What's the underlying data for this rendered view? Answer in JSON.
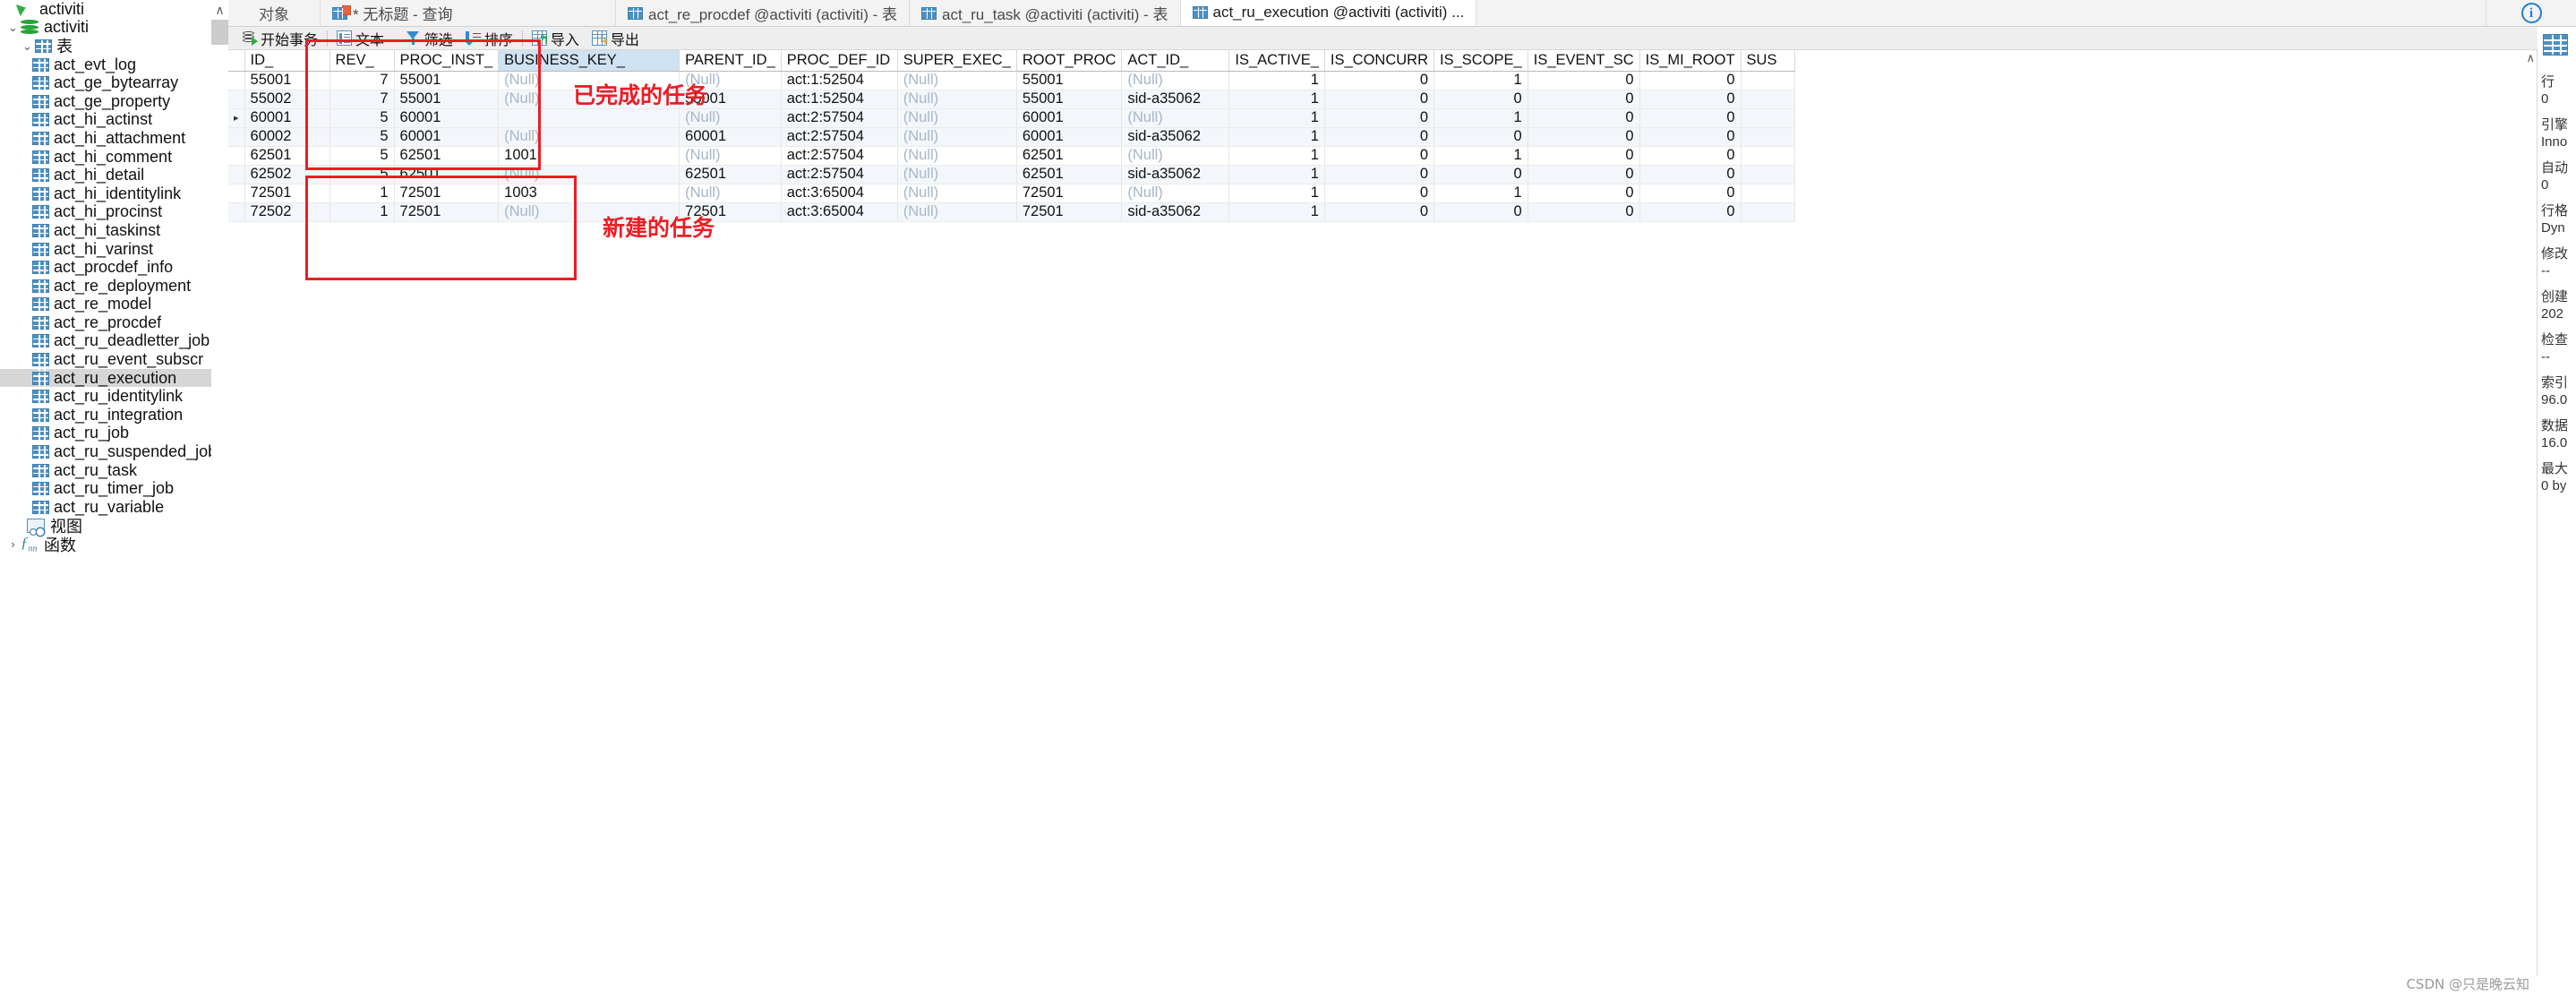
{
  "sidebar": {
    "connection": "activiti",
    "database": "activiti",
    "tables_group": "表",
    "views_group": "视图",
    "functions_group": "函数",
    "tables": [
      "act_evt_log",
      "act_ge_bytearray",
      "act_ge_property",
      "act_hi_actinst",
      "act_hi_attachment",
      "act_hi_comment",
      "act_hi_detail",
      "act_hi_identitylink",
      "act_hi_procinst",
      "act_hi_taskinst",
      "act_hi_varinst",
      "act_procdef_info",
      "act_re_deployment",
      "act_re_model",
      "act_re_procdef",
      "act_ru_deadletter_job",
      "act_ru_event_subscr",
      "act_ru_execution",
      "act_ru_identitylink",
      "act_ru_integration",
      "act_ru_job",
      "act_ru_suspended_job",
      "act_ru_task",
      "act_ru_timer_job",
      "act_ru_variable"
    ],
    "selected_table": "act_ru_execution"
  },
  "tabs": [
    {
      "label": "对象",
      "icon": "none",
      "active": false
    },
    {
      "label": "* 无标题 - 查询",
      "icon": "query-icon",
      "active": false
    },
    {
      "label": "act_re_procdef @activiti (activiti) - 表",
      "icon": "table-icon",
      "active": false
    },
    {
      "label": "act_ru_task @activiti (activiti) - 表",
      "icon": "table-icon",
      "active": false
    },
    {
      "label": "act_ru_execution @activiti (activiti) ...",
      "icon": "table-icon",
      "active": true
    }
  ],
  "toolbar": {
    "begin_transaction": "开始事务",
    "text": "文本 ·",
    "filter": "筛选",
    "sort": "排序",
    "import": "导入",
    "export": "导出"
  },
  "grid": {
    "columns": [
      "ID_",
      "REV_",
      "PROC_INST_",
      "BUSINESS_KEY_",
      "PARENT_ID_",
      "PROC_DEF_ID",
      "SUPER_EXEC_",
      "ROOT_PROC",
      "ACT_ID_",
      "IS_ACTIVE_",
      "IS_CONCURR",
      "IS_SCOPE_",
      "IS_EVENT_SC",
      "IS_MI_ROOT",
      "SUS"
    ],
    "highlighted_column": "BUSINESS_KEY_",
    "rows": [
      {
        "mark": "",
        "ID_": "55001",
        "REV_": "7",
        "PROC_INST_": "55001",
        "BUSINESS_KEY_": "(Null)",
        "PARENT_ID_": "(Null)",
        "PROC_DEF_ID": "act:1:52504",
        "SUPER_EXEC_": "(Null)",
        "ROOT_PROC": "55001",
        "ACT_ID_": "(Null)",
        "IS_ACTIVE_": "1",
        "IS_CONCURR": "0",
        "IS_SCOPE_": "1",
        "IS_EVENT_SC": "0",
        "IS_MI_ROOT": "0",
        "SUS": ""
      },
      {
        "mark": "",
        "ID_": "55002",
        "REV_": "7",
        "PROC_INST_": "55001",
        "BUSINESS_KEY_": "(Null)",
        "PARENT_ID_": "55001",
        "PROC_DEF_ID": "act:1:52504",
        "SUPER_EXEC_": "(Null)",
        "ROOT_PROC": "55001",
        "ACT_ID_": "sid-a35062",
        "IS_ACTIVE_": "1",
        "IS_CONCURR": "0",
        "IS_SCOPE_": "0",
        "IS_EVENT_SC": "0",
        "IS_MI_ROOT": "0",
        "SUS": ""
      },
      {
        "mark": "▸",
        "ID_": "60001",
        "REV_": "5",
        "PROC_INST_": "60001",
        "BUSINESS_KEY_": "",
        "PARENT_ID_": "(Null)",
        "PROC_DEF_ID": "act:2:57504",
        "SUPER_EXEC_": "(Null)",
        "ROOT_PROC": "60001",
        "ACT_ID_": "(Null)",
        "IS_ACTIVE_": "1",
        "IS_CONCURR": "0",
        "IS_SCOPE_": "1",
        "IS_EVENT_SC": "0",
        "IS_MI_ROOT": "0",
        "SUS": ""
      },
      {
        "mark": "",
        "ID_": "60002",
        "REV_": "5",
        "PROC_INST_": "60001",
        "BUSINESS_KEY_": "(Null)",
        "PARENT_ID_": "60001",
        "PROC_DEF_ID": "act:2:57504",
        "SUPER_EXEC_": "(Null)",
        "ROOT_PROC": "60001",
        "ACT_ID_": "sid-a35062",
        "IS_ACTIVE_": "1",
        "IS_CONCURR": "0",
        "IS_SCOPE_": "0",
        "IS_EVENT_SC": "0",
        "IS_MI_ROOT": "0",
        "SUS": ""
      },
      {
        "mark": "",
        "ID_": "62501",
        "REV_": "5",
        "PROC_INST_": "62501",
        "BUSINESS_KEY_": "1001",
        "PARENT_ID_": "(Null)",
        "PROC_DEF_ID": "act:2:57504",
        "SUPER_EXEC_": "(Null)",
        "ROOT_PROC": "62501",
        "ACT_ID_": "(Null)",
        "IS_ACTIVE_": "1",
        "IS_CONCURR": "0",
        "IS_SCOPE_": "1",
        "IS_EVENT_SC": "0",
        "IS_MI_ROOT": "0",
        "SUS": ""
      },
      {
        "mark": "",
        "ID_": "62502",
        "REV_": "5",
        "PROC_INST_": "62501",
        "BUSINESS_KEY_": "(Null)",
        "PARENT_ID_": "62501",
        "PROC_DEF_ID": "act:2:57504",
        "SUPER_EXEC_": "(Null)",
        "ROOT_PROC": "62501",
        "ACT_ID_": "sid-a35062",
        "IS_ACTIVE_": "1",
        "IS_CONCURR": "0",
        "IS_SCOPE_": "0",
        "IS_EVENT_SC": "0",
        "IS_MI_ROOT": "0",
        "SUS": ""
      },
      {
        "mark": "",
        "ID_": "72501",
        "REV_": "1",
        "PROC_INST_": "72501",
        "BUSINESS_KEY_": "1003",
        "PARENT_ID_": "(Null)",
        "PROC_DEF_ID": "act:3:65004",
        "SUPER_EXEC_": "(Null)",
        "ROOT_PROC": "72501",
        "ACT_ID_": "(Null)",
        "IS_ACTIVE_": "1",
        "IS_CONCURR": "0",
        "IS_SCOPE_": "1",
        "IS_EVENT_SC": "0",
        "IS_MI_ROOT": "0",
        "SUS": ""
      },
      {
        "mark": "",
        "ID_": "72502",
        "REV_": "1",
        "PROC_INST_": "72501",
        "BUSINESS_KEY_": "(Null)",
        "PARENT_ID_": "72501",
        "PROC_DEF_ID": "act:3:65004",
        "SUPER_EXEC_": "(Null)",
        "ROOT_PROC": "72501",
        "ACT_ID_": "sid-a35062",
        "IS_ACTIVE_": "1",
        "IS_CONCURR": "0",
        "IS_SCOPE_": "0",
        "IS_EVENT_SC": "0",
        "IS_MI_ROOT": "0",
        "SUS": ""
      }
    ]
  },
  "annotations": {
    "completed_tasks": "已完成的任务",
    "new_tasks": "新建的任务",
    "color": "#ee1c24"
  },
  "rightpanel": {
    "rows_label": "行",
    "rows_value": "0",
    "engine_label": "引擎",
    "engine_value": "Inno",
    "auto_label": "自动",
    "auto_value": "0",
    "rowformat_label": "行格",
    "rowformat_value": "Dyn",
    "modified_label": "修改",
    "modified_value": "--",
    "created_label": "创建",
    "created_value": "202",
    "check_label": "检查",
    "check_value": "--",
    "index_label": "索引",
    "index_value": "96.0",
    "data_label": "数据",
    "data_value": "16.0",
    "max_label": "最大",
    "max_value": "0 by"
  },
  "watermark": "CSDN @只是晚云知"
}
